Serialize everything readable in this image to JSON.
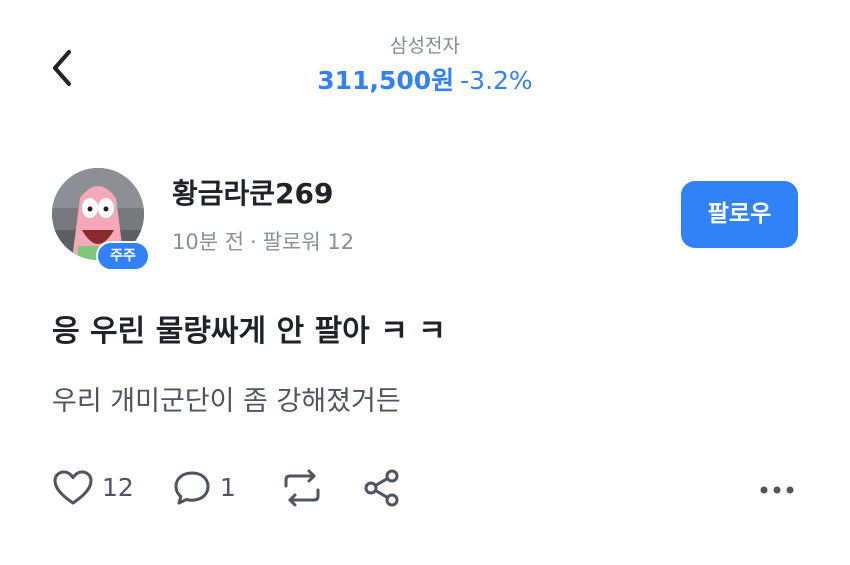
{
  "header": {
    "stock_name": "삼성전자",
    "stock_price": "311,500원",
    "stock_change": "-3.2%",
    "accent_color": "#3182f6"
  },
  "post": {
    "author": "황금라쿤269",
    "badge": "주주",
    "time": "10분 전",
    "followers": "팔로워 12",
    "follow_label": "팔로우",
    "title": "응 우린 물량싸게 안 팔아 ㅋ ㅋ",
    "body": "우리 개미군단이 좀 강해졌거든"
  },
  "actions": {
    "likes": "12",
    "comments": "1"
  },
  "icons": {
    "back": "chevron-left-icon",
    "like": "heart-icon",
    "comment": "comment-bubble-icon",
    "repost": "repost-icon",
    "share": "share-icon",
    "more": "more-horizontal-icon"
  }
}
